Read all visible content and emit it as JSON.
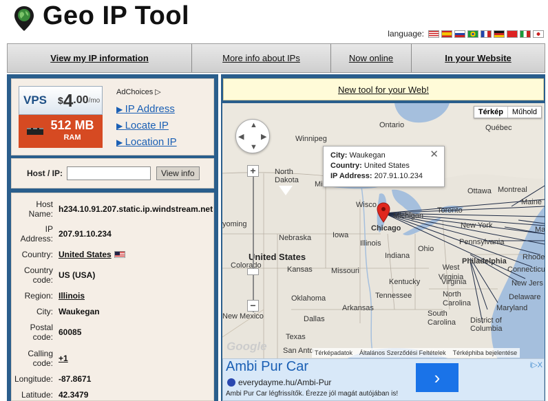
{
  "header": {
    "title": "Geo IP Tool",
    "language_label": "language:",
    "flags": [
      "us",
      "es",
      "ru",
      "br",
      "fr",
      "de",
      "cn",
      "it",
      "jp"
    ]
  },
  "nav": {
    "items": [
      {
        "label": "View my IP information",
        "bold": true
      },
      {
        "label": "More info about IPs",
        "bold": false
      },
      {
        "label": "Now online",
        "bold": false
      },
      {
        "label": "In your Website",
        "bold": true
      }
    ]
  },
  "ad": {
    "vps_word": "VPS",
    "dollar": "$",
    "price": "4",
    "cents": ".00",
    "per": "/mo",
    "ram_size": "512 MB",
    "ram_label": "RAM",
    "adchoices": "AdChoices",
    "links": [
      "IP Address",
      "Locate IP",
      "Location IP"
    ]
  },
  "search": {
    "label": "Host / IP:",
    "value": "",
    "button": "View info"
  },
  "info": {
    "host_name_label": "Host Name:",
    "host_name": "h234.10.91.207.static.ip.windstream.net",
    "ip_label": "IP Address:",
    "ip": "207.91.10.234",
    "country_label": "Country:",
    "country": "United States",
    "country_code_label": "Country code:",
    "country_code": "US (USA)",
    "region_label": "Region:",
    "region": "Illinois",
    "city_label": "City:",
    "city": "Waukegan",
    "postal_label": "Postal code:",
    "postal": "60085",
    "calling_label": "Calling code:",
    "calling": "+1",
    "longitude_label": "Longitude:",
    "longitude": "-87.8671",
    "latitude_label": "Latitude:",
    "latitude": "42.3479"
  },
  "right": {
    "new_tool": "New tool for your Web!"
  },
  "map": {
    "type_map": "Térkép",
    "type_sat": "Műhold",
    "popup": {
      "city_label": "City:",
      "city": "Waukegan",
      "country_label": "Country:",
      "country": "United States",
      "ip_label": "IP Address:",
      "ip": "207.91.10.234"
    },
    "labels": {
      "ontario": "Ontario",
      "quebec": "Québec",
      "winnipeg": "Winnipeg",
      "north_dakota": "North Dakota",
      "minnesota": "Minnesota",
      "ottawa": "Ottawa",
      "montreal": "Montreal",
      "maine": "Maine",
      "wisconsin": "Wisco",
      "michigan": "Michigan",
      "toronto": "Toronto",
      "new_york": "New York",
      "wyoming": "yoming",
      "nebraska": "Nebraska",
      "iowa": "Iowa",
      "chicago": "Chicago",
      "illinois": "Illinois",
      "ohio": "Ohio",
      "pennsylvania": "Pennsylvania",
      "united_states": "United States",
      "colorado": "Colorado",
      "kansas": "Kansas",
      "missouri": "Missouri",
      "indiana": "Indiana",
      "west_virginia": "West Virginia",
      "philadelphia": "Philadelphia",
      "rhode": "Rhode",
      "connecticut": "Connecticut",
      "new_jersey": "New Jers",
      "kentucky": "Kentucky",
      "virginia": "Virginia",
      "delaware": "Delaware",
      "maryland": "Maryland",
      "tennessee": "Tennessee",
      "oklahoma": "Oklahoma",
      "arkansas": "Arkansas",
      "north_carolina": "North Carolina",
      "south_carolina": "South Carolina",
      "dc": "District of Columbia",
      "new_mexico": "New Mexico",
      "dallas": "Dallas",
      "texas": "Texas",
      "san_antonio": "San Anto",
      "ma": "Ma"
    },
    "attribution": [
      "Térképadatok",
      "Általános Szerződési Feltételek",
      "Térképhiba bejelentése"
    ],
    "google": "Google"
  },
  "bottom_ad": {
    "title": "Ambi Pur Car",
    "url": "everydayme.hu/Ambi-Pur",
    "desc": "Ambi Pur Car légfrissítők. Érezze jól magát autójában is!",
    "arrow": "›",
    "choices": "i▷X"
  },
  "colors": {
    "panel_blue": "#2a5e8c",
    "panel_bg": "#f5eee6",
    "link_blue": "#1a5fb4",
    "ad_orange": "#d64a22"
  }
}
